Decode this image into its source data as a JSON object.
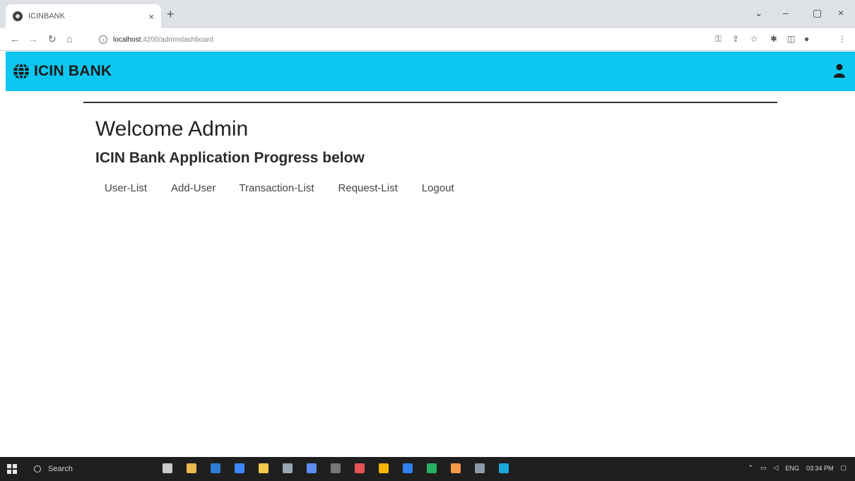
{
  "browser": {
    "tab_title": "ICINBANK",
    "tab_close": "×",
    "new_tab": "+",
    "url_host": "localhost",
    "url_path": ":4200/admindashboard",
    "controls": {
      "dropdown": "⌄",
      "minimize": "–",
      "restore": "▢",
      "close": "×"
    }
  },
  "navbar": {
    "brand": "ICIN BANK",
    "bg_color": "#0dc7f0"
  },
  "main": {
    "welcome": "Welcome Admin",
    "subtitle": "ICIN Bank Application Progress below",
    "menu": [
      {
        "label": "User-List"
      },
      {
        "label": "Add-User"
      },
      {
        "label": "Transaction-List"
      },
      {
        "label": "Request-List"
      },
      {
        "label": "Logout"
      }
    ]
  },
  "taskbar": {
    "search_placeholder": "Search",
    "lang": "ENG",
    "time": "03:34 PM"
  }
}
